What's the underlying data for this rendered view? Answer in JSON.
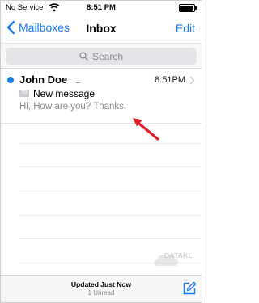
{
  "status_bar": {
    "carrier": "No Service",
    "wifi_icon": "wifi-icon",
    "time": "8:51 PM",
    "battery_icon": "battery-icon"
  },
  "nav": {
    "back_label": "Mailboxes",
    "title": "Inbox",
    "edit_label": "Edit"
  },
  "search": {
    "placeholder": "Search",
    "icon": "search-icon"
  },
  "messages": [
    {
      "unread": true,
      "sender": "John Doe",
      "time": "8:51PM",
      "to_badge": "TO",
      "subject": "New message",
      "preview": "Hi, How are you? Thanks."
    }
  ],
  "toolbar": {
    "status": "Updated Just Now",
    "unread_count": "1 Unread",
    "compose_icon": "compose-icon"
  },
  "watermark": {
    "text": "DATAKL"
  },
  "colors": {
    "accent": "#1a7cf5",
    "unread_dot": "#1a7cf5",
    "annotation_arrow": "#e0202a",
    "secondary_text": "#8a8a8f"
  }
}
